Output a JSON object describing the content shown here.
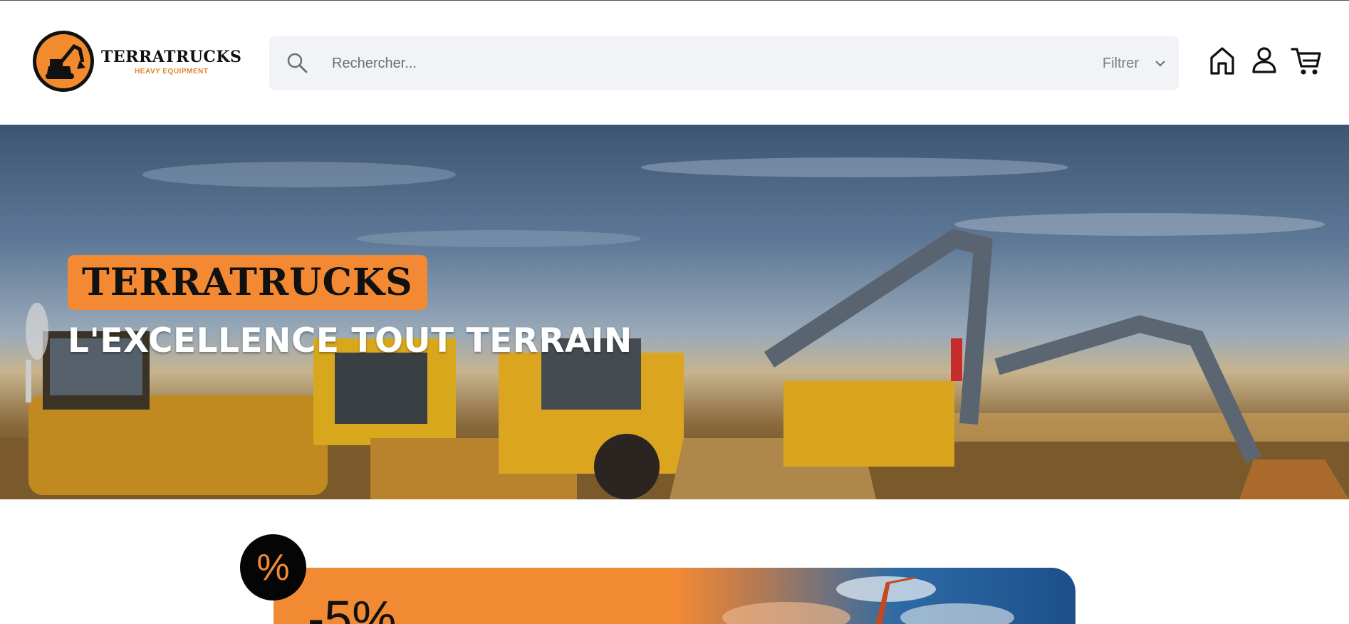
{
  "header": {
    "logo": {
      "name": "TERRATRUCKS",
      "tagline": "HEAVY EQUIPMENT"
    },
    "search": {
      "placeholder": "Rechercher...",
      "value": "",
      "filter_label": "Filtrer"
    },
    "icons": [
      "home-icon",
      "user-icon",
      "cart-icon"
    ]
  },
  "hero": {
    "brand": "TERRATRUCKS",
    "tagline": "L'EXCELLENCE TOUT TERRAIN"
  },
  "promo": {
    "badge_symbol": "%",
    "discount": "-5%"
  },
  "colors": {
    "accent": "#f38a33",
    "search_bg": "#f2f3f7",
    "text_dark": "#111111"
  }
}
